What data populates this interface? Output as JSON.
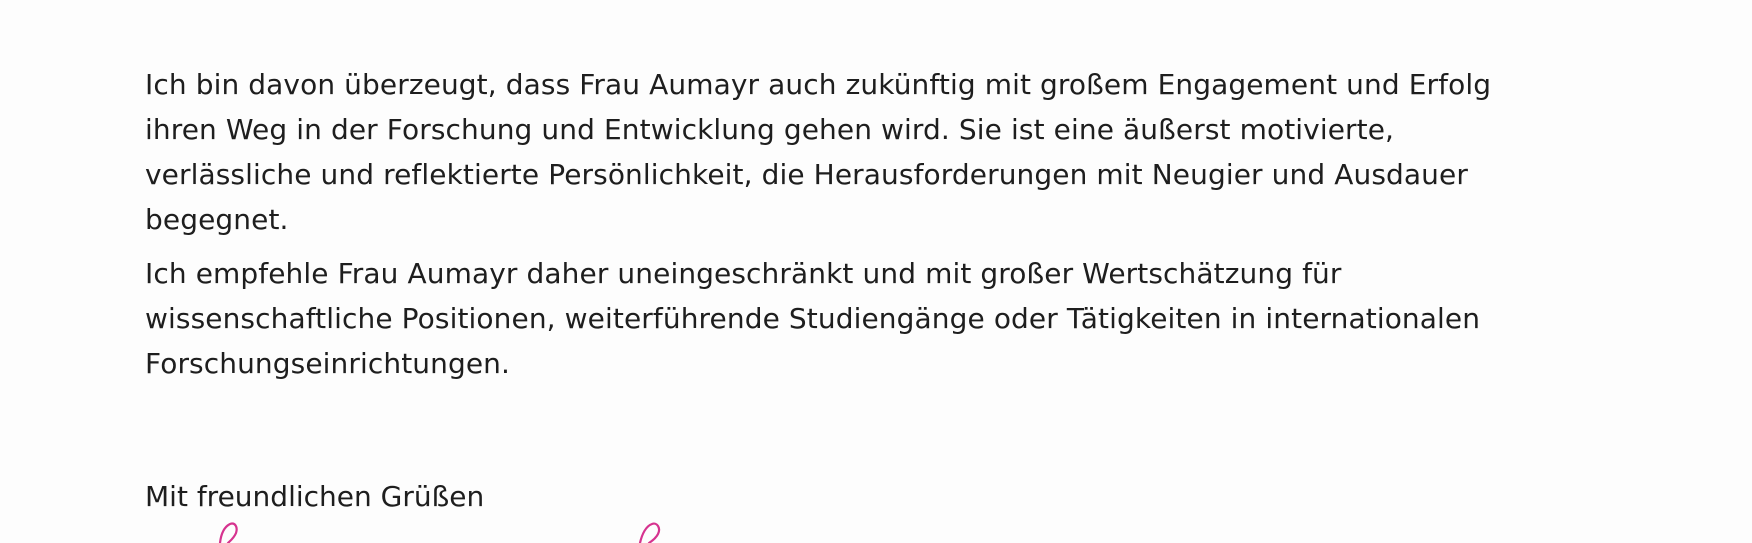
{
  "letter": {
    "paragraphs": [
      {
        "lines": [
          "Ich bin davon überzeugt, dass Frau Aumayr auch zukünftig mit großem Engagement und Erfolg",
          "ihren Weg in der Forschung und Entwicklung gehen wird. Sie ist eine äußerst motivierte,",
          "verlässliche und reflektierte Persönlichkeit, die Herausforderungen mit Neugier und Ausdauer",
          "begegnet."
        ]
      },
      {
        "lines": [
          "Ich empfehle Frau Aumayr daher uneingeschränkt und mit großer Wertschätzung für",
          "wissenschaftliche Positionen, weiterführende Studiengänge oder Tätigkeiten in internationalen",
          "Forschungseinrichtungen."
        ]
      }
    ],
    "closing": "Mit freundlichen Grüßen"
  },
  "colors": {
    "text": "#1e1e1e",
    "signature_ink": "#d6338f",
    "paper": "#fdfdfd"
  }
}
